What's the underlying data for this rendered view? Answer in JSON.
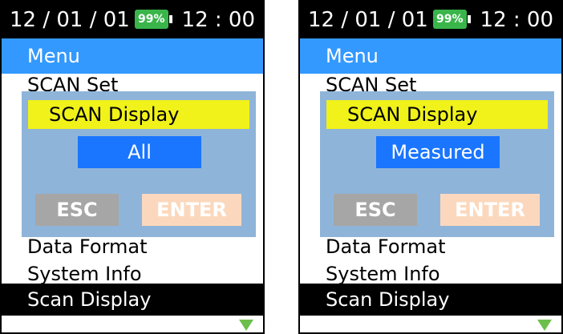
{
  "screens": [
    {
      "status": {
        "date": "12 / 01 / 01",
        "battery": "99%",
        "time": "12 : 00"
      },
      "menu_title": "Menu",
      "items": [
        "SCAN Set",
        "Data Format",
        "System Info"
      ],
      "selected_item": "Scan Display",
      "dialog": {
        "title": "SCAN Display",
        "value": "All",
        "esc_label": "ESC",
        "enter_label": "ENTER"
      }
    },
    {
      "status": {
        "date": "12 / 01 / 01",
        "battery": "99%",
        "time": "12 : 00"
      },
      "menu_title": "Menu",
      "items": [
        "SCAN Set",
        "Data Format",
        "System Info"
      ],
      "selected_item": "Scan Display",
      "dialog": {
        "title": "SCAN Display",
        "value": "Measured",
        "esc_label": "ESC",
        "enter_label": "ENTER"
      }
    }
  ],
  "colors": {
    "menu_bar": "#3399ff",
    "battery": "#39b54a",
    "dialog_bg": "#8fb4d9",
    "dialog_title": "#f0f21a",
    "value_box": "#1a75ff",
    "esc_button": "#a6a6a6",
    "enter_button": "#fbd8bd",
    "scroll_arrow": "#6dbf4b"
  },
  "icons": {
    "battery": "battery-icon",
    "scroll": "scroll-down-arrow-icon"
  }
}
